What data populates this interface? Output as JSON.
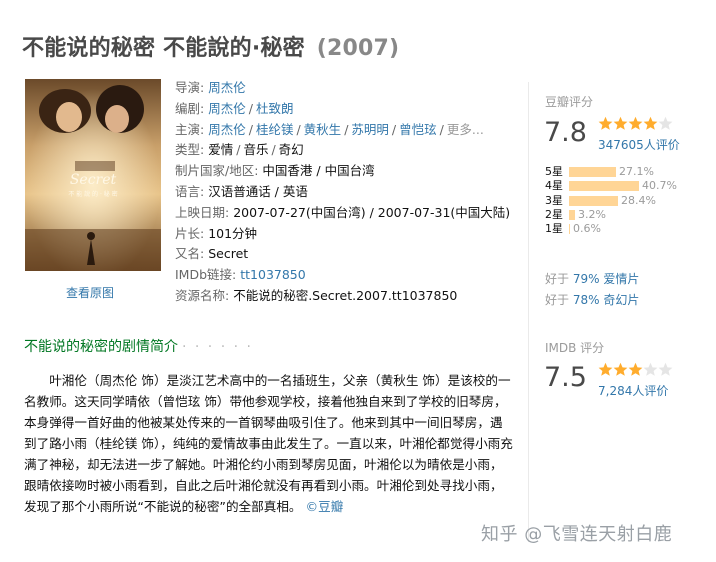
{
  "title": {
    "main": "不能说的秘密 不能說的·秘密",
    "year": "(2007)"
  },
  "poster": {
    "alt": "Secret poster",
    "link": "查看原图"
  },
  "info": {
    "director": {
      "label": "导演:",
      "names": [
        "周杰伦"
      ]
    },
    "writer": {
      "label": "编剧:",
      "names": [
        "周杰伦",
        "杜致朗"
      ]
    },
    "cast": {
      "label": "主演:",
      "names": [
        "周杰伦",
        "桂纶镁",
        "黄秋生",
        "苏明明",
        "曾恺玹"
      ],
      "more": "更多..."
    },
    "genre": {
      "label": "类型:",
      "values": [
        "爱情",
        "音乐",
        "奇幻"
      ]
    },
    "country": {
      "label": "制片国家/地区:",
      "value": "中国香港 / 中国台湾"
    },
    "language": {
      "label": "语言:",
      "value": "汉语普通话 / 英语"
    },
    "release": {
      "label": "上映日期:",
      "value": "2007-07-27(中国台湾) / 2007-07-31(中国大陆)"
    },
    "runtime": {
      "label": "片长:",
      "value": "101分钟"
    },
    "aka": {
      "label": "又名:",
      "value": "Secret"
    },
    "imdb": {
      "label": "IMDb链接:",
      "value": "tt1037850"
    },
    "resource": {
      "label": "资源名称:",
      "value": "不能说的秘密.Secret.2007.tt1037850"
    }
  },
  "douban": {
    "label": "豆瓣评分",
    "score": "7.8",
    "stars": 4,
    "count": "347605人评价",
    "distribution": [
      {
        "label": "5星",
        "pct": "27.1%",
        "value": 27.1
      },
      {
        "label": "4星",
        "pct": "40.7%",
        "value": 40.7
      },
      {
        "label": "3星",
        "pct": "28.4%",
        "value": 28.4
      },
      {
        "label": "2星",
        "pct": "3.2%",
        "value": 3.2
      },
      {
        "label": "1星",
        "pct": "0.6%",
        "value": 0.6
      }
    ],
    "better": [
      {
        "prefix": "好于",
        "pct": "79%",
        "genre": "爱情片"
      },
      {
        "prefix": "好于",
        "pct": "78%",
        "genre": "奇幻片"
      }
    ]
  },
  "imdb_rating": {
    "label": "IMDB 评分",
    "score": "7.5",
    "stars": 3.5,
    "count": "7,284人评价"
  },
  "summary": {
    "title": "不能说的秘密的剧情简介",
    "dots": "· · · · · ·",
    "text": "叶湘伦（周杰伦 饰）是淡江艺术高中的一名插班生，父亲（黄秋生 饰）是该校的一名教师。这天同学晴依（曾恺玹 饰）带他参观学校，接着他独自来到了学校的旧琴房，本身弹得一首好曲的他被某处传来的一首钢琴曲吸引住了。他来到其中一间旧琴房，遇到了路小雨（桂纶镁 饰），纯纯的爱情故事由此发生了。一直以来，叶湘伦都觉得小雨充满了神秘，却无法进一步了解她。叶湘伦约小雨到琴房见面，叶湘伦以为晴依是小雨，跟晴依接吻时被小雨看到，自此之后叶湘伦就没有再看到小雨。叶湘伦到处寻找小雨，发现了那个小雨所说“不能说的秘密”的全部真相。",
    "source": "©豆瓣"
  },
  "watermark": "知乎 @飞雪连天射白鹿",
  "colors": {
    "link": "#3377aa",
    "title": "#494949",
    "summary_title": "#007722",
    "star": "#ffac2d",
    "bar": "#ffd596"
  }
}
